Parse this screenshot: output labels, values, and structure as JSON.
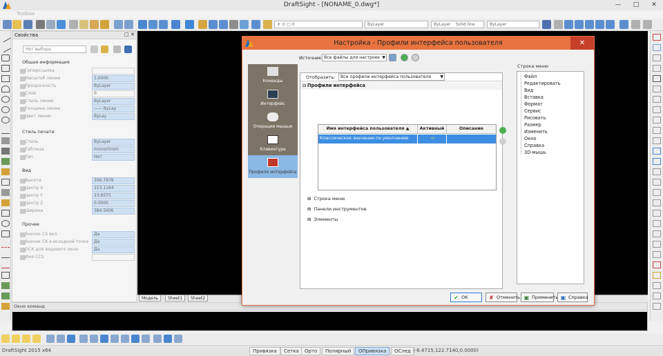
{
  "window": {
    "title": "DraftSight - [NONAME_0.dwg*]",
    "toolbox_label": "Toolbox"
  },
  "toolbar": {
    "color_combo": "ByLayer",
    "linetype_combo": "ByLayer",
    "linetype_name": "Solid line",
    "lineweight_combo": "ByLayer",
    "layer_combo": "☀ ⊙ □ 0"
  },
  "properties": {
    "title": "Свойства",
    "selection": "Нет выбора",
    "sections": {
      "general": "Общая информация",
      "plot_style": "Стиль печати",
      "view": "Вид",
      "other": "Прочее"
    },
    "general_rows": [
      {
        "label": "Гиперссылка",
        "value": ""
      },
      {
        "label": "Масштаб линии",
        "value": "1.0000"
      },
      {
        "label": "Прозрачность",
        "value": "ByLayer"
      },
      {
        "label": "Слой",
        "value": "0"
      },
      {
        "label": "Стиль линии",
        "value": "ByLayer"
      },
      {
        "label": "Толщина линии",
        "value": "—— ByLay"
      },
      {
        "label": "Цвет линии",
        "value": "ByLay"
      }
    ],
    "plot_rows": [
      {
        "label": "Стиль",
        "value": "ByLayer"
      },
      {
        "label": "Таблица",
        "value": "monochrom"
      },
      {
        "label": "Тип",
        "value": "Нет"
      }
    ],
    "view_rows": [
      {
        "label": "Высота",
        "value": "206.7978"
      },
      {
        "label": "Центр X",
        "value": "213.1164"
      },
      {
        "label": "Центр Y",
        "value": "23.6575"
      },
      {
        "label": "Центр Z",
        "value": "0.0000"
      },
      {
        "label": "Ширина",
        "value": "384.5606"
      }
    ],
    "other_rows": [
      {
        "label": "Значок CS вкл",
        "value": "Да"
      },
      {
        "label": "Значок CK в исходной точке",
        "value": "Да"
      },
      {
        "label": "ОСК для видового окна",
        "value": "Да"
      },
      {
        "label": "Имя CCS",
        "value": ""
      }
    ]
  },
  "model_tabs": [
    "Модель",
    "Sheet1",
    "Sheet2"
  ],
  "command_window": {
    "title": "Окно команд"
  },
  "status": {
    "app": "DraftSight 2015 x64",
    "buttons": [
      {
        "label": "Привязка",
        "on": false
      },
      {
        "label": "Сетка",
        "on": false
      },
      {
        "label": "Орто",
        "on": false
      },
      {
        "label": "Полярный",
        "on": false
      },
      {
        "label": "ОПривязка",
        "on": true
      },
      {
        "label": "ОСлед",
        "on": false
      }
    ],
    "coords": "(-6.4715,122.7140,0.0000)"
  },
  "dialog": {
    "title": "Настройка - Профили интерфейса пользователя",
    "source_label": "Источник:",
    "source_value": "Все файлы для настроек",
    "categories": [
      {
        "label": "Команды",
        "active": false
      },
      {
        "label": "Интерфейс",
        "active": false
      },
      {
        "label": "Операции мышью",
        "active": false
      },
      {
        "label": "Клавиатура",
        "active": false
      },
      {
        "label": "Профили интерфейса",
        "active": true
      }
    ],
    "display_label": "Отобразить:",
    "display_value": "Все профили интерфейса пользователя",
    "profiles_header": "Профили интерфейса",
    "grid": {
      "columns": [
        "Имя интерфейса пользователя",
        "Активный",
        "Описание"
      ],
      "rows": [
        {
          "name": "Классическое значение по умолчанию",
          "active": "⇨",
          "description": ""
        }
      ]
    },
    "expanders": [
      "Строка меню",
      "Панели инструментов",
      "Элементы"
    ],
    "menu_label": "Строка меню",
    "menu_items": [
      "Файл",
      "Редактировать",
      "Вид",
      "Вставка",
      "Формат",
      "Сервис",
      "Рисовать",
      "Размер",
      "Изменить",
      "Окно",
      "Справка",
      "3D-мышь"
    ],
    "buttons": {
      "ok": "ОК",
      "cancel": "Отменить",
      "apply": "Применить",
      "help": "Справка"
    }
  },
  "colors": {
    "accent": "#e8733f",
    "selection": "#3d8ee2",
    "canvas": "#000000"
  }
}
